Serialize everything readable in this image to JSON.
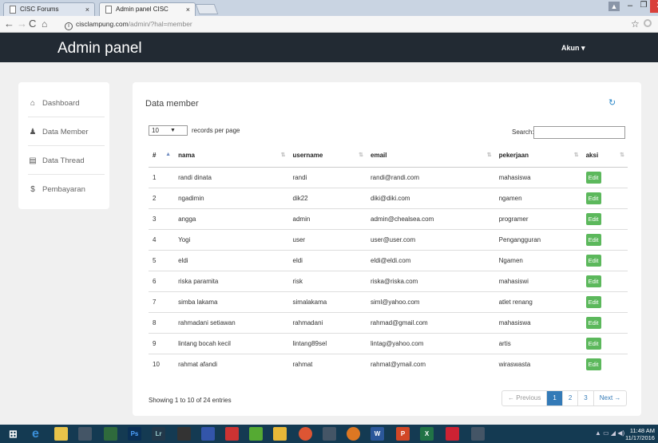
{
  "browser": {
    "tabs": [
      {
        "title": "CISC Forums",
        "close": "×"
      },
      {
        "title": "Admin panel CISC",
        "close": "×"
      }
    ],
    "url_host": "cisclampung.com",
    "url_path": "/admin/?hal=member",
    "back_icon": "arrow-left",
    "forward_icon": "arrow-right",
    "reload_icon": "reload",
    "home_icon": "home",
    "star_icon": "star"
  },
  "header": {
    "title": "Admin panel",
    "account_label": "Akun ▾"
  },
  "sidebar": {
    "items": [
      {
        "label": "Dashboard",
        "icon": "⌂"
      },
      {
        "label": "Data Member",
        "icon": "👤"
      },
      {
        "label": "Data Thread",
        "icon": "▤"
      },
      {
        "label": "Pembayaran",
        "icon": "$"
      }
    ]
  },
  "main": {
    "title": "Data member",
    "page_length": "10",
    "page_length_label": "records per page",
    "search_label": "Search:",
    "search_value": "",
    "columns": [
      "#",
      "nama",
      "username",
      "email",
      "pekerjaan",
      "aksi"
    ],
    "rows": [
      [
        "1",
        "randi dinata",
        "randi",
        "randi@randi.com",
        "mahasiswa",
        "Edit"
      ],
      [
        "2",
        "ngadimin",
        "dik22",
        "diki@diki.com",
        "ngamen",
        "Edit"
      ],
      [
        "3",
        "angga",
        "admin",
        "admin@chealsea.com",
        "programer",
        "Edit"
      ],
      [
        "4",
        "Yogi",
        "user",
        "user@user.com",
        "Pengangguran",
        "Edit"
      ],
      [
        "5",
        "eldi",
        "eldi",
        "eldi@eldi.com",
        "Ngamen",
        "Edit"
      ],
      [
        "6",
        "riska paramita",
        "risk",
        "riska@riska.com",
        "mahasiswi",
        "Edit"
      ],
      [
        "7",
        "simba lakama",
        "simalakama",
        "siml@yahoo.com",
        "atlet renang",
        "Edit"
      ],
      [
        "8",
        "rahmadani setiawan",
        "rahmadani",
        "rahmad@gmail.com",
        "mahasiswa",
        "Edit"
      ],
      [
        "9",
        "lintang bocah kecil",
        "lintang89sel",
        "lintag@yahoo.com",
        "artis",
        "Edit"
      ],
      [
        "10",
        "rahmat afandi",
        "rahmat",
        "rahmat@ymail.com",
        "wiraswasta",
        "Edit"
      ]
    ],
    "showing": "Showing 1 to 10 of 24 entries",
    "pagination": [
      "← Previous",
      "1",
      "2",
      "3",
      "Next →"
    ],
    "active_page": "1"
  },
  "taskbar": {
    "clock_time": "11:48 AM",
    "clock_date": "11/17/2016"
  },
  "colors": {
    "header_bg": "#222a33",
    "edit_button": "#5cb85c",
    "pagination_active": "#337ab7",
    "taskbar_bg": "#143a52"
  }
}
